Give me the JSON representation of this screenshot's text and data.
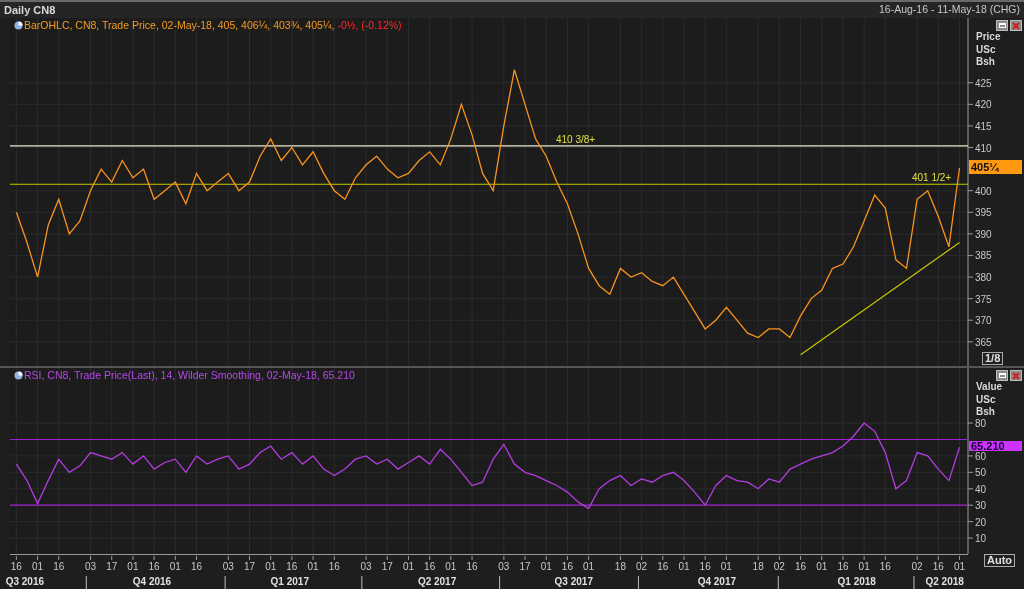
{
  "title": "Daily CN8",
  "date_range": "16-Aug-16 - 11-May-18 (CHG)",
  "price_panel": {
    "legend": "BarOHLC, CN8, Trade Price, 02-May-18, 405, 406¼, 403¾, 405¼, ",
    "legend_change": "-0½, (-0.12%)",
    "axis_title": [
      "Price",
      "USc",
      "Bsh"
    ],
    "last_value": "405¼",
    "scale_button": "1/8",
    "chart_data": {
      "type": "line",
      "grid": true,
      "ylim": [
        359.4,
        440.0
      ],
      "yticks": [
        365,
        370,
        375,
        380,
        385,
        390,
        395,
        400,
        410,
        415,
        420,
        425
      ],
      "series": [
        {
          "color": "#f7931e",
          "values": [
            395,
            388,
            380,
            392,
            398,
            390,
            393,
            400,
            405,
            402,
            407,
            403,
            405,
            398,
            400,
            402,
            397,
            404,
            400,
            402,
            404,
            400,
            402,
            408,
            412,
            407,
            410,
            406,
            409,
            404,
            400,
            398,
            403,
            406,
            408,
            405,
            403,
            404,
            407,
            409,
            406,
            412,
            420,
            413,
            404,
            400,
            415,
            428,
            420,
            412,
            408,
            402,
            397,
            390,
            382,
            378,
            376,
            382,
            380,
            381,
            379,
            378,
            380,
            376,
            372,
            368,
            370,
            373,
            370,
            367,
            366,
            368,
            368,
            366,
            371,
            375,
            377,
            382,
            383,
            387,
            393,
            399,
            396,
            384,
            382,
            398,
            400,
            394,
            387,
            405.25
          ]
        },
        {
          "color": "#c8c800",
          "values": [
            null,
            null,
            null,
            null,
            null,
            null,
            null,
            null,
            null,
            null,
            null,
            null,
            null,
            null,
            null,
            null,
            null,
            null,
            null,
            null,
            null,
            null,
            null,
            null,
            null,
            null,
            null,
            null,
            null,
            null,
            null,
            null,
            null,
            null,
            null,
            null,
            null,
            null,
            null,
            null,
            null,
            null,
            null,
            null,
            null,
            null,
            null,
            null,
            null,
            null,
            null,
            null,
            null,
            null,
            null,
            null,
            null,
            null,
            null,
            null,
            null,
            null,
            null,
            null,
            null,
            null,
            null,
            null,
            null,
            null,
            null,
            null,
            null,
            null,
            362,
            null,
            null,
            null,
            null,
            null,
            null,
            null,
            null,
            null,
            null,
            null,
            null,
            null,
            null,
            388
          ]
        }
      ],
      "ref_lines": [
        {
          "axis": "y",
          "value": 410.375,
          "label": "410 3/8+",
          "color": "#e8e8c8"
        },
        {
          "axis": "y",
          "value": 401.5,
          "label": "401 1/2+",
          "color": "#c8c800"
        }
      ]
    }
  },
  "rsi_panel": {
    "legend": "RSI, CN8, Trade Price(Last),  14, Wilder Smoothing, 02-May-18, 65.210",
    "axis_title": [
      "Value",
      "USc",
      "Bsh"
    ],
    "last_value": "65.210",
    "scale_button": "Auto",
    "chart_data": {
      "type": "line",
      "grid": true,
      "ylim": [
        0.3,
        113.5
      ],
      "yticks": [
        10,
        20,
        30,
        40,
        50,
        60,
        80
      ],
      "categories": [
        "16",
        null,
        "01",
        null,
        "16",
        null,
        null,
        "03",
        null,
        "17",
        null,
        "01",
        null,
        "16",
        null,
        "01",
        null,
        "16",
        null,
        null,
        "03",
        null,
        "17",
        null,
        "01",
        null,
        "16",
        null,
        "01",
        null,
        "16",
        null,
        null,
        "03",
        null,
        "17",
        null,
        "01",
        null,
        "16",
        null,
        "01",
        null,
        "16",
        null,
        null,
        "03",
        null,
        "17",
        null,
        "01",
        null,
        "16",
        null,
        "01",
        null,
        null,
        "18",
        null,
        "02",
        null,
        "16",
        null,
        "01",
        null,
        "16",
        null,
        "01",
        null,
        null,
        "18",
        null,
        "02",
        null,
        "16",
        null,
        "01",
        null,
        "16",
        null,
        "01",
        null,
        "16",
        null,
        null,
        "02",
        null,
        "16",
        null,
        "01"
      ],
      "series": [
        {
          "color": "#b23ce0",
          "values": [
            55,
            45,
            31,
            45,
            58,
            50,
            54,
            62,
            60,
            58,
            62,
            55,
            60,
            52,
            56,
            58,
            50,
            60,
            55,
            58,
            60,
            52,
            55,
            62,
            66,
            58,
            62,
            55,
            60,
            52,
            48,
            52,
            58,
            60,
            55,
            58,
            52,
            56,
            60,
            55,
            64,
            58,
            50,
            42,
            44,
            58,
            67,
            55,
            50,
            48,
            45,
            42,
            38,
            32,
            28,
            40,
            45,
            48,
            42,
            46,
            44,
            48,
            50,
            45,
            38,
            30,
            42,
            48,
            45,
            44,
            40,
            46,
            44,
            52,
            55,
            58,
            60,
            62,
            66,
            72,
            80,
            75,
            62,
            40,
            45,
            62,
            60,
            52,
            45,
            65.21
          ]
        }
      ],
      "ref_lines": [
        {
          "axis": "y",
          "value": 70,
          "color": "#a020d0"
        },
        {
          "axis": "y",
          "value": 30,
          "color": "#a020d0"
        }
      ]
    }
  },
  "x_axis": {
    "quarters": [
      "Q3 2016",
      "Q4 2016",
      "Q1 2017",
      "Q2 2017",
      "Q3 2017",
      "Q4 2017",
      "Q1 2018",
      "Q2 2018"
    ]
  }
}
